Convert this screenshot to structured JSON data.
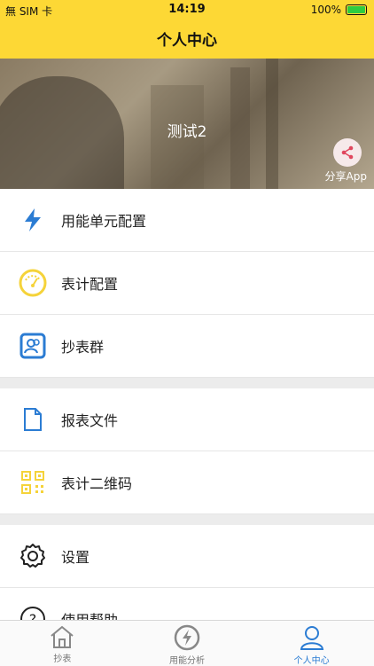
{
  "status_bar": {
    "carrier": "無 SIM 卡",
    "time": "14:19",
    "battery": "100%"
  },
  "nav": {
    "title": "个人中心"
  },
  "banner": {
    "user_name": "测试2",
    "share_label": "分享App"
  },
  "menu": {
    "group1": [
      {
        "label": "用能单元配置",
        "icon": "lightning-icon"
      },
      {
        "label": "表计配置",
        "icon": "gauge-icon"
      },
      {
        "label": "抄表群",
        "icon": "group-icon"
      }
    ],
    "group2": [
      {
        "label": "报表文件",
        "icon": "file-icon"
      },
      {
        "label": "表计二维码",
        "icon": "qrcode-icon"
      }
    ],
    "group3": [
      {
        "label": "设置",
        "icon": "gear-icon"
      },
      {
        "label": "使用帮助",
        "icon": "help-icon"
      }
    ]
  },
  "tabs": [
    {
      "label": "抄表",
      "icon": "home-icon",
      "active": false
    },
    {
      "label": "用能分析",
      "icon": "energy-icon",
      "active": false
    },
    {
      "label": "个人中心",
      "icon": "person-icon",
      "active": true
    }
  ],
  "colors": {
    "header_yellow": "#FDD835",
    "accent_blue": "#2b7cd3",
    "icon_yellow": "#F5D33A"
  }
}
